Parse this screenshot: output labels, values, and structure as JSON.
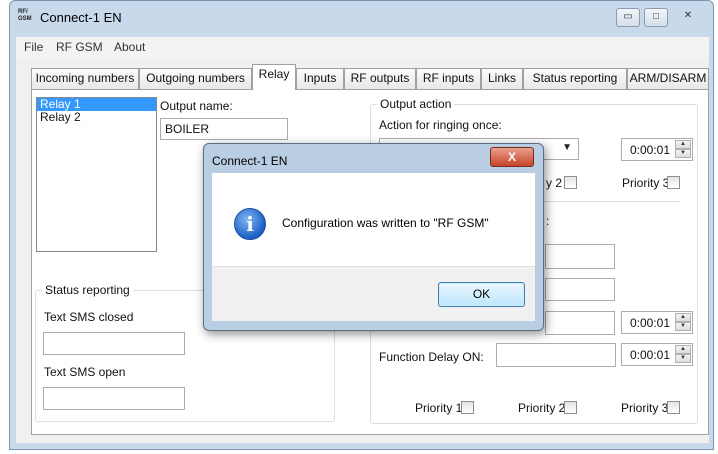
{
  "window": {
    "title": "Connect-1 EN",
    "app_icon_text": "RF/ GSM",
    "caption_buttons": {
      "minimize": "▭",
      "maximize": "□",
      "close": "✕"
    }
  },
  "menu": [
    "File",
    "RF GSM",
    "About"
  ],
  "tabs": [
    "Incoming numbers",
    "Outgoing numbers",
    "Relay",
    "Inputs",
    "RF outputs",
    "RF inputs",
    "Links",
    "Status reporting",
    "ARM/DISARM"
  ],
  "relay": {
    "list": [
      "Relay 1",
      "Relay 2"
    ],
    "output_name_label": "Output name:",
    "output_name_value": "BOILER",
    "status_reporting": {
      "title": "Status reporting",
      "closed_label": "Text SMS closed",
      "closed_value": "",
      "open_label": "Text SMS open",
      "open_value": ""
    },
    "output_action": {
      "title": "Output action",
      "ringing_label": "Action for ringing once:",
      "ringing_select_value": "",
      "ringing_time": "0:00:01",
      "priority_2_fragment": "y 2",
      "priority_3": "Priority 3",
      "section2_fragment": ":",
      "delay_off_time": "0:00:01",
      "delay_on_label": "Function Delay ON:",
      "delay_on_value": "",
      "delay_on_time": "0:00:01",
      "bottom_priorities": [
        "Priority 1",
        "Priority 2",
        "Priority 3"
      ]
    }
  },
  "dialog": {
    "title": "Connect-1 EN",
    "close_label": "X",
    "icon": "info-icon",
    "message": "Configuration was written to \"RF GSM\"",
    "ok_label": "OK"
  }
}
